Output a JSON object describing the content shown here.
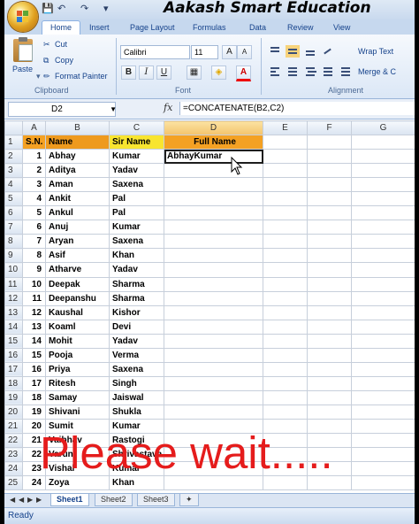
{
  "app_title": "Aakash Smart Education",
  "quick_access": [
    "save-icon",
    "undo-icon",
    "redo-icon"
  ],
  "tabs": [
    {
      "label": "Home",
      "active": true
    },
    {
      "label": "Insert"
    },
    {
      "label": "Page Layout"
    },
    {
      "label": "Formulas"
    },
    {
      "label": "Data"
    },
    {
      "label": "Review"
    },
    {
      "label": "View"
    }
  ],
  "ribbon": {
    "clipboard": {
      "paste": "Paste",
      "cut": "Cut",
      "copy": "Copy",
      "format_painter": "Format Painter",
      "label": "Clipboard"
    },
    "font": {
      "name": "Calibri",
      "size": "11",
      "label": "Font",
      "bold": "B",
      "italic": "I",
      "underline": "U"
    },
    "alignment": {
      "wrap_text": "Wrap Text",
      "merge": "Merge & C",
      "label": "Alignment"
    }
  },
  "formula_bar": {
    "name_box": "D2",
    "fx": "fx",
    "formula": "=CONCATENATE(B2,C2)"
  },
  "columns": [
    "A",
    "B",
    "C",
    "D",
    "E",
    "F",
    "G"
  ],
  "header_row": {
    "sn": "S.N.",
    "name": "Name",
    "sir_name": "Sir Name",
    "full_name": "Full Name"
  },
  "rows": [
    {
      "sn": "1",
      "name": "Abhay",
      "sir": "Kumar",
      "full": "AbhayKumar"
    },
    {
      "sn": "2",
      "name": "Aditya",
      "sir": "Yadav",
      "full": ""
    },
    {
      "sn": "3",
      "name": "Aman",
      "sir": "Saxena",
      "full": ""
    },
    {
      "sn": "4",
      "name": "Ankit",
      "sir": "Pal",
      "full": ""
    },
    {
      "sn": "5",
      "name": "Ankul",
      "sir": "Pal",
      "full": ""
    },
    {
      "sn": "6",
      "name": "Anuj",
      "sir": "Kumar",
      "full": ""
    },
    {
      "sn": "7",
      "name": "Aryan",
      "sir": "Saxena",
      "full": ""
    },
    {
      "sn": "8",
      "name": "Asif",
      "sir": "Khan",
      "full": ""
    },
    {
      "sn": "9",
      "name": "Atharve",
      "sir": "Yadav",
      "full": ""
    },
    {
      "sn": "10",
      "name": "Deepak",
      "sir": "Sharma",
      "full": ""
    },
    {
      "sn": "11",
      "name": "Deepanshu",
      "sir": "Sharma",
      "full": ""
    },
    {
      "sn": "12",
      "name": "Kaushal",
      "sir": "Kishor",
      "full": ""
    },
    {
      "sn": "13",
      "name": "Koaml",
      "sir": "Devi",
      "full": ""
    },
    {
      "sn": "14",
      "name": "Mohit",
      "sir": "Yadav",
      "full": ""
    },
    {
      "sn": "15",
      "name": "Pooja",
      "sir": "Verma",
      "full": ""
    },
    {
      "sn": "16",
      "name": "Priya",
      "sir": "Saxena",
      "full": ""
    },
    {
      "sn": "17",
      "name": "Ritesh",
      "sir": "Singh",
      "full": ""
    },
    {
      "sn": "18",
      "name": "Samay",
      "sir": "Jaiswal",
      "full": ""
    },
    {
      "sn": "19",
      "name": "Shivani",
      "sir": "Shukla",
      "full": ""
    },
    {
      "sn": "20",
      "name": "Sumit",
      "sir": "Kumar",
      "full": ""
    },
    {
      "sn": "21",
      "name": "Vaibhav",
      "sir": "Rastogi",
      "full": ""
    },
    {
      "sn": "22",
      "name": "Varun",
      "sir": "Shrivastava",
      "full": ""
    },
    {
      "sn": "23",
      "name": "Vishal",
      "sir": "Kumar",
      "full": ""
    },
    {
      "sn": "24",
      "name": "Zoya",
      "sir": "Khan",
      "full": ""
    }
  ],
  "sheets": [
    "Sheet1",
    "Sheet2",
    "Sheet3"
  ],
  "status": "Ready",
  "overlay_text": "Please wait.....",
  "colors": {
    "header_sn": "#f4a123",
    "header_name": "#ee9a1e",
    "header_sir": "#f8e530",
    "header_full": "#f4a123",
    "overlay": "#e51c1c"
  }
}
